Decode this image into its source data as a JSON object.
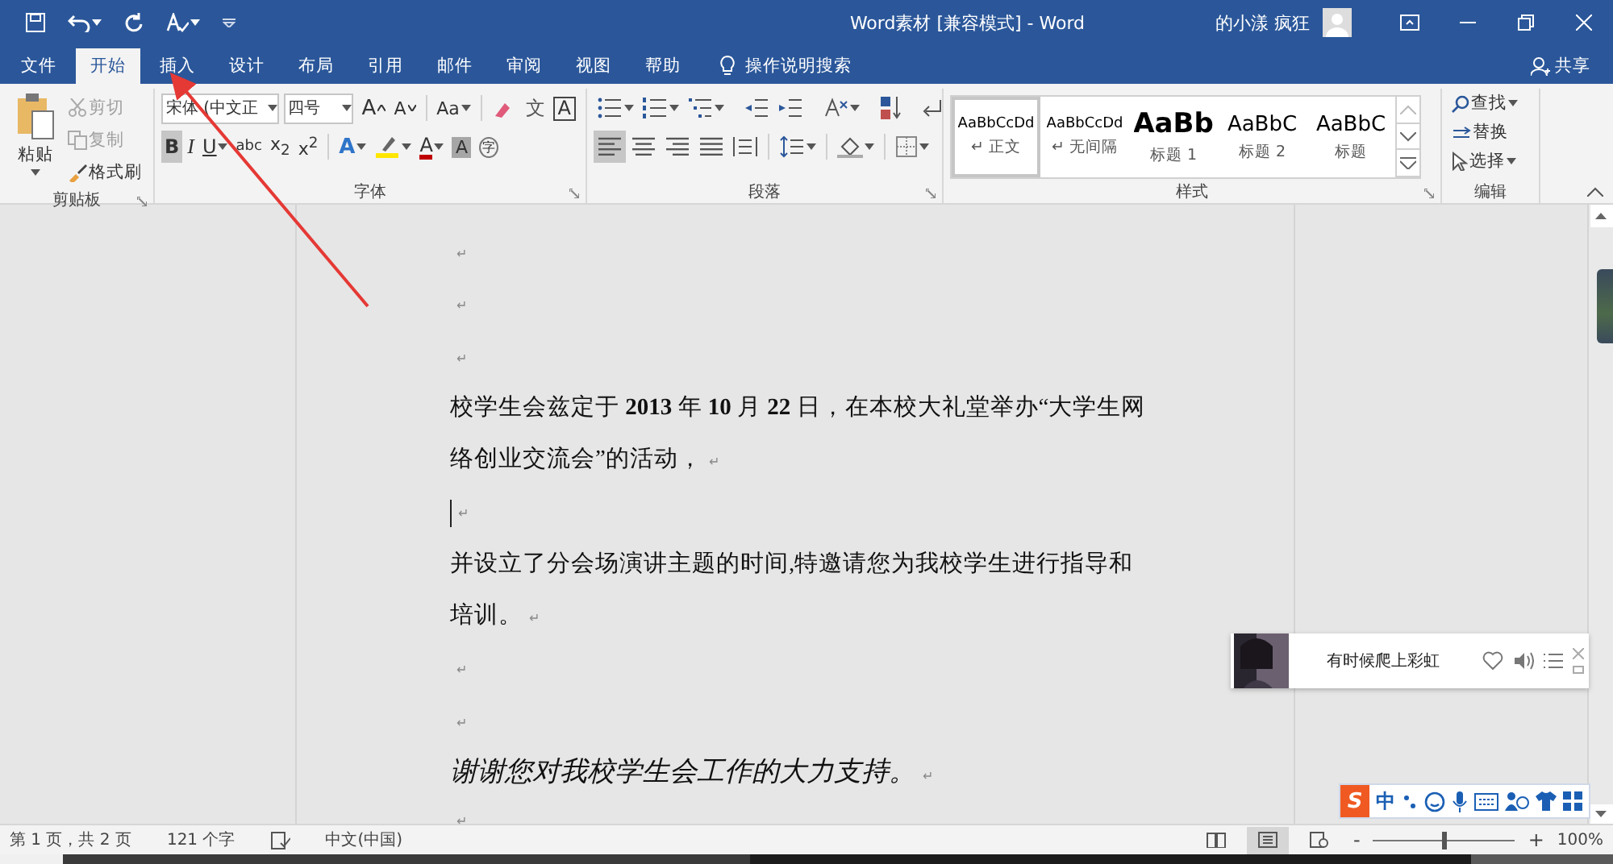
{
  "title_bar": {
    "quick_access": [
      {
        "kind": "save",
        "dropdown": false
      },
      {
        "kind": "undo",
        "dropdown": true
      },
      {
        "kind": "redo",
        "dropdown": false
      },
      {
        "kind": "format",
        "dropdown": true
      },
      {
        "kind": "customize",
        "dropdown": false
      }
    ],
    "title": "Word素材 [兼容模式]  -  Word",
    "user": "的小漾 疯狂"
  },
  "tabs": [
    {
      "label": "文件",
      "selected": false
    },
    {
      "label": "开始",
      "selected": true
    },
    {
      "label": "插入",
      "selected": false
    },
    {
      "label": "设计",
      "selected": false
    },
    {
      "label": "布局",
      "selected": false
    },
    {
      "label": "引用",
      "selected": false
    },
    {
      "label": "邮件",
      "selected": false
    },
    {
      "label": "审阅",
      "selected": false
    },
    {
      "label": "视图",
      "selected": false
    },
    {
      "label": "帮助",
      "selected": false
    }
  ],
  "tell_me": "操作说明搜索",
  "share": "共享",
  "ribbon": {
    "clipboard": {
      "label": "剪贴板",
      "paste": "粘贴",
      "items": [
        {
          "kind": "cut",
          "label": "剪切",
          "disabled": true
        },
        {
          "kind": "copy",
          "label": "复制",
          "disabled": true
        },
        {
          "kind": "brush",
          "label": "格式刷",
          "disabled": false
        }
      ]
    },
    "font": {
      "label": "字体",
      "font_name": "宋体 (中文正",
      "font_size": "四号",
      "row1": [
        {
          "kind": "grow",
          "label": "A",
          "dropdown": false,
          "selected": false
        },
        {
          "kind": "shrink",
          "label": "A",
          "dropdown": false,
          "selected": false
        },
        {
          "kind": "case",
          "label": "Aa",
          "dropdown": true,
          "selected": false
        },
        {
          "kind": "clear",
          "dropdown": false,
          "selected": false
        },
        {
          "kind": "phonetic",
          "label": "文",
          "dropdown": false,
          "selected": false
        },
        {
          "kind": "boxed",
          "label": "A",
          "dropdown": false,
          "selected": false
        }
      ],
      "row2": [
        {
          "kind": "bold",
          "label": "B",
          "dropdown": false,
          "selected": true
        },
        {
          "kind": "italic",
          "label": "I",
          "dropdown": false,
          "selected": false
        },
        {
          "kind": "underline",
          "label": "U",
          "dropdown": true,
          "selected": false
        },
        {
          "kind": "strike",
          "label": "abc",
          "dropdown": false,
          "selected": false
        },
        {
          "kind": "script",
          "label": "x$_{2}$",
          "dropdown": false,
          "selected": false
        },
        {
          "kind": "script",
          "label": "x$^{2}$",
          "dropdown": false,
          "selected": false
        },
        {
          "kind": "effect",
          "label": "A",
          "dropdown": true,
          "selected": false
        },
        {
          "kind": "highlight",
          "dropdown": true,
          "selected": false
        },
        {
          "kind": "color",
          "label": "A",
          "dropdown": true,
          "selected": false
        },
        {
          "kind": "shaded",
          "label": "A",
          "dropdown": false,
          "selected": false
        },
        {
          "kind": "enclose",
          "label": "字",
          "dropdown": false,
          "selected": false
        }
      ]
    },
    "paragraph": {
      "label": "段落",
      "row1": [
        {
          "kind": "bullets",
          "dropdown": true,
          "selected": false
        },
        {
          "kind": "numbering",
          "dropdown": true,
          "selected": false
        },
        {
          "kind": "multilevel",
          "dropdown": true,
          "selected": false
        },
        {
          "kind": "outdent",
          "dropdown": false,
          "selected": false
        },
        {
          "kind": "indent",
          "dropdown": false,
          "selected": false
        },
        {
          "kind": "layout",
          "dropdown": true,
          "selected": false
        },
        {
          "kind": "sort",
          "dropdown": false,
          "selected": false
        },
        {
          "kind": "marks",
          "dropdown": false,
          "selected": false
        }
      ],
      "row2": [
        {
          "kind": "align-left",
          "dropdown": false,
          "selected": true
        },
        {
          "kind": "align-center",
          "dropdown": false,
          "selected": false
        },
        {
          "kind": "align-right",
          "dropdown": false,
          "selected": false
        },
        {
          "kind": "justify",
          "dropdown": false,
          "selected": false
        },
        {
          "kind": "distribute",
          "dropdown": false,
          "selected": false
        },
        {
          "kind": "spacing",
          "dropdown": true,
          "selected": false
        },
        {
          "kind": "shading",
          "dropdown": true,
          "selected": false
        },
        {
          "kind": "borders",
          "dropdown": true,
          "selected": false
        }
      ]
    },
    "styles": {
      "label": "样式",
      "items": [
        {
          "kind": "normal",
          "preview": "AaBbCcDd",
          "name": "↵ 正文",
          "selected": true
        },
        {
          "kind": "normal",
          "preview": "AaBbCcDd",
          "name": "↵ 无间隔",
          "selected": false
        },
        {
          "kind": "heading1",
          "preview": "AaBb",
          "name": "标题 1",
          "selected": false
        },
        {
          "kind": "heading2",
          "preview": "AaBbC",
          "name": "标题 2",
          "selected": false
        },
        {
          "kind": "title",
          "preview": "AaBbC",
          "name": "标题",
          "selected": false
        }
      ]
    },
    "editing": {
      "label": "编辑",
      "items": [
        {
          "kind": "find",
          "label": "查找",
          "dropdown": true
        },
        {
          "kind": "replace",
          "label": "替换",
          "dropdown": false
        },
        {
          "kind": "select",
          "label": "选择",
          "dropdown": true
        }
      ]
    }
  },
  "document": {
    "paragraphs": [
      {
        "mark": "↵"
      },
      {
        "mark": "↵"
      },
      {
        "mark": "↵"
      },
      {
        "text": "校学生会兹定于 **2013** 年 **10** 月 **22** 日，在本校大礼堂举办“大学生网络创业交流会”的活动，",
        "mark": "↵",
        "italic": false
      },
      {
        "mark": "↵",
        "caret": true
      },
      {
        "text": "并设立了分会场演讲主题的时间,特邀请您为我校学生进行指导和培训。",
        "mark": "↵",
        "italic": false
      },
      {
        "mark": "↵"
      },
      {
        "mark": "↵"
      },
      {
        "text": "谢谢您对我校学生会工作的大力支持。",
        "mark": "↵",
        "italic": true
      },
      {
        "mark": "↵"
      }
    ]
  },
  "music_player": {
    "song": "有时候爬上彩虹"
  },
  "ime_bar": {
    "logo": "S",
    "mode": "中"
  },
  "status_bar": {
    "page": "第 1 页，共 2 页",
    "words": "121 个字",
    "language": "中文(中国)",
    "views": [
      {
        "kind": "read",
        "selected": false
      },
      {
        "kind": "print",
        "selected": true
      },
      {
        "kind": "web",
        "selected": false
      }
    ],
    "zoom_out": "-",
    "zoom": {
      "level": 0.5
    },
    "zoom_in": "+",
    "zoom_reading": "100%"
  },
  "annotation_arrow": true
}
